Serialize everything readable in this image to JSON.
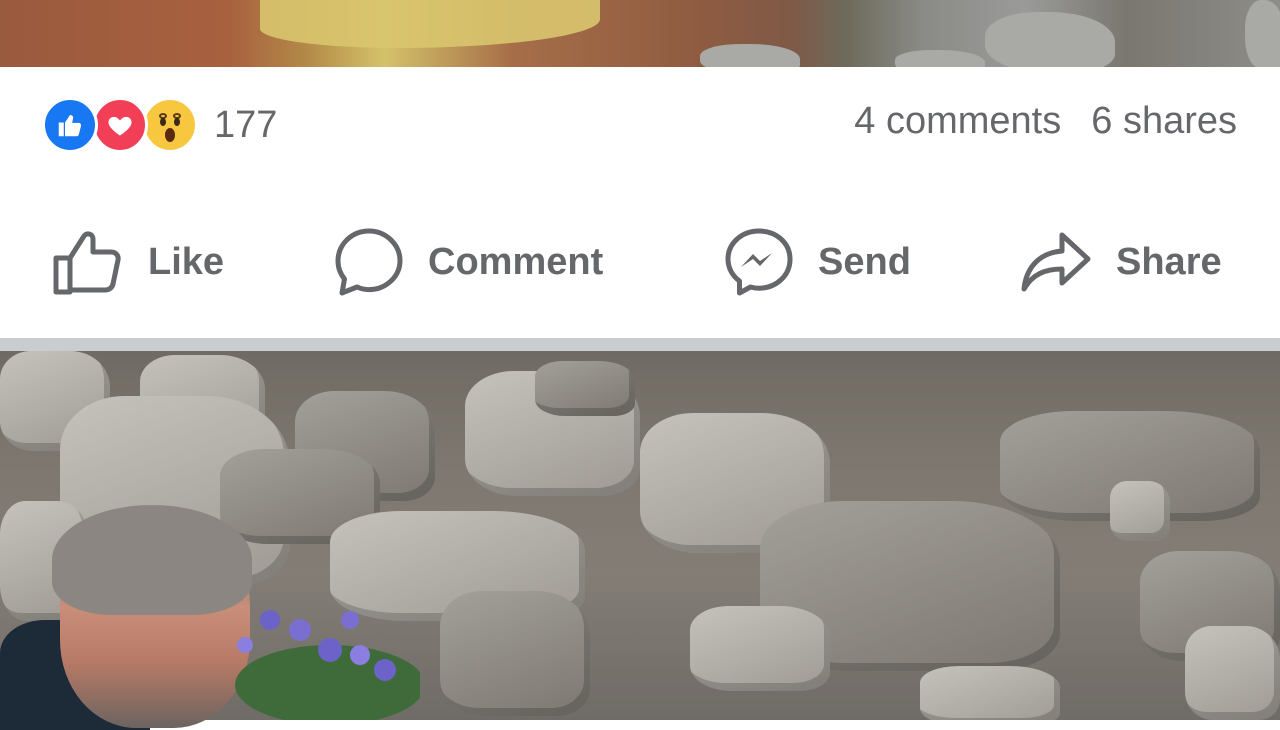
{
  "post": {
    "reactions": {
      "icons": [
        "like-reaction",
        "love-reaction",
        "wow-reaction"
      ],
      "count": "177"
    },
    "comments": "4 comments",
    "shares": "6 shares"
  },
  "actions": {
    "like": "Like",
    "comment": "Comment",
    "send": "Send",
    "share": "Share"
  },
  "colors": {
    "like_blue": "#1877f2",
    "love_red": "#f33e58",
    "wow_yellow": "#f7c83f",
    "text_gray": "#65676b",
    "divider_gray": "#c9ccd1"
  }
}
